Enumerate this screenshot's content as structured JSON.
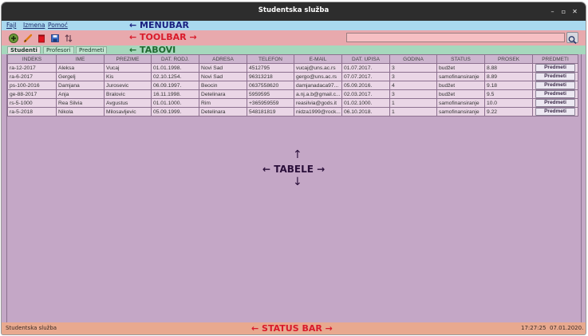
{
  "window": {
    "title": "Studentska služba"
  },
  "menubar": {
    "items": [
      {
        "label": "Fajl"
      },
      {
        "label": "Izmena"
      },
      {
        "label": "Pomoć"
      }
    ],
    "annotation": "← MENUBAR"
  },
  "toolbar": {
    "buttons": [
      "add-icon",
      "edit-icon",
      "delete-icon",
      "save-icon",
      "sort-icon"
    ],
    "search": {
      "value": ""
    },
    "annotation": "← TOOLBAR →"
  },
  "tabs": {
    "items": [
      {
        "label": "Studenti"
      },
      {
        "label": "Profesori"
      },
      {
        "label": "Predmeti"
      }
    ],
    "active": 0,
    "annotation": "← TABOVI"
  },
  "table": {
    "columns": [
      "INDEKS",
      "IME",
      "PREZIME",
      "DAT. RODJ.",
      "ADRESA",
      "TELEFON",
      "E-MAIL",
      "DAT. UPISA",
      "GODINA",
      "STATUS",
      "PROSEK",
      "PREDMETI"
    ],
    "rows": [
      [
        "ra-12-2017",
        "Aleksa",
        "Vucaj",
        "01.01.1998.",
        "Novi Sad",
        "4512795",
        "vucaj@uns.ac.rs",
        "01.07.2017.",
        "3",
        "budžet",
        "8.88",
        "Predmeti"
      ],
      [
        "ra-6-2017",
        "Gergelj",
        "Kis",
        "02.10.1254.",
        "Novi Sad",
        "96313218",
        "gergo@uns.ac.rs",
        "07.07.2017.",
        "3",
        "samofinansiranje",
        "8.89",
        "Predmeti"
      ],
      [
        "ps-100-2016",
        "Damjana",
        "Jurosevic",
        "06.09.1997.",
        "Beocin",
        "0637558620",
        "damjanadaca97...",
        "05.09.2016.",
        "4",
        "budžet",
        "9.18",
        "Predmeti"
      ],
      [
        "ge-88-2017",
        "Anja",
        "Bralovic",
        "16.11.1998.",
        "Detelinara",
        "5959595",
        "a.nj.a.b@gmail.c...",
        "02.03.2017.",
        "3",
        "budžet",
        "9.5",
        "Predmeti"
      ],
      [
        "rs-5-1000",
        "Rea Silvia",
        "Avgustus",
        "01.01.1000.",
        "Rim",
        "+365959559",
        "reasilvia@gods.it",
        "01.02.1000.",
        "1",
        "samofinansiranje",
        "10.0",
        "Predmeti"
      ],
      [
        "ra-5-2018",
        "Nikola",
        "Milosavljevic",
        "05.09.1999.",
        "Detelinara",
        "548181819",
        "nidza1999@rock...",
        "06.10.2018.",
        "1",
        "samofinansiranje",
        "9.22",
        "Predmeti"
      ]
    ],
    "annotation": "← TABELE →"
  },
  "statusbar": {
    "left": "Studentska služba",
    "time": "17:27:25",
    "date": "07.01.2020.",
    "annotation": "← STATUS BAR →"
  },
  "colors": {
    "menubar": "#a9d9ef",
    "toolbar": "#e8a9ad",
    "tabs": "#a6d8bd",
    "table_bg": "#c4a7c6",
    "statusbar": "#e8a98f",
    "annotation_menubar": "#1a2080",
    "annotation_toolbar": "#d91a2a",
    "annotation_tabs": "#1f6b30",
    "annotation_tabele": "#2a0f3a",
    "annotation_status": "#d91a2a"
  }
}
